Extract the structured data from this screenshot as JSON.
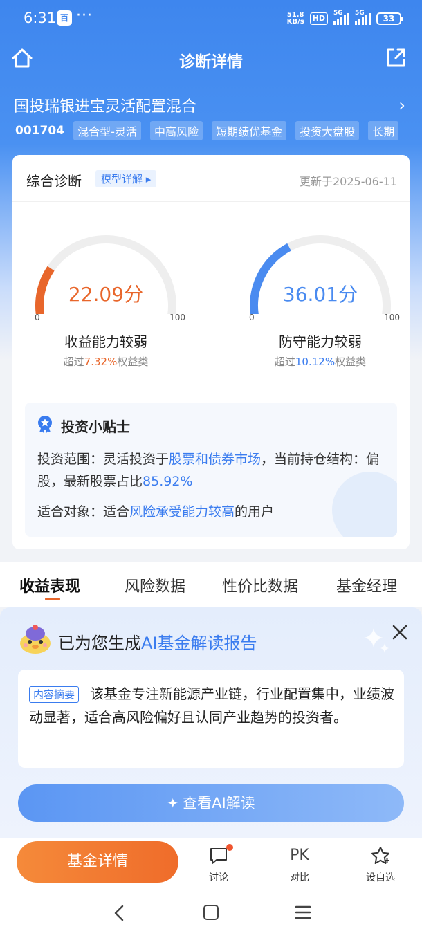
{
  "status_bar": {
    "time": "6:31",
    "app_badge": "百",
    "more": "···",
    "net_speed_value": "51.8",
    "net_speed_unit": "KB/s",
    "hd": "HD",
    "signal1": "5G",
    "signal2": "5G",
    "battery": "33"
  },
  "nav": {
    "title": "诊断详情"
  },
  "fund": {
    "name": "国投瑞银进宝灵活配置混合",
    "code": "001704",
    "tags": [
      "混合型-灵活",
      "中高风险",
      "短期绩优基金",
      "投资大盘股",
      "长期"
    ]
  },
  "diagnosis": {
    "title": "综合诊断",
    "model_link": "模型详解 ▸",
    "update_time": "更新于2025-06-11",
    "return_gauge": {
      "score": "22.09分",
      "score_value": 22.09,
      "min": "0",
      "max": "100",
      "label": "收益能力较弱",
      "sub_prefix": "超过",
      "sub_pct": "7.32%",
      "sub_suffix": "权益类",
      "color": "#e8662b"
    },
    "defense_gauge": {
      "score": "36.01分",
      "score_value": 36.01,
      "min": "0",
      "max": "100",
      "label": "防守能力较弱",
      "sub_prefix": "超过",
      "sub_pct": "10.12%",
      "sub_suffix": "权益类",
      "color": "#4a8bf0"
    },
    "tips": {
      "title": "投资小贴士",
      "scope_prefix": "投资范围：灵活投资于",
      "scope_hl": "股票和债券市场",
      "scope_mid": "，当前持仓结构：偏股，最新股票占比",
      "scope_pct": "85.92%",
      "target_prefix": "适合对象：适合",
      "target_hl": "风险承受能力较高",
      "target_suffix": "的用户"
    }
  },
  "tabs": [
    {
      "label": "收益表现",
      "active": true
    },
    {
      "label": "风险数据",
      "active": false
    },
    {
      "label": "性价比数据",
      "active": false
    },
    {
      "label": "基金经理",
      "active": false
    }
  ],
  "ai": {
    "title_prefix": "已为您生成",
    "title_hl": "AI基金解读报告",
    "summary_tag": "内容摘要",
    "summary_text": "该基金专注新能源产业链，行业配置集中，业绩波动显著，适合高风险偏好且认同产业趋势的投资者。",
    "button": "查看AI解读"
  },
  "bottom_bar": {
    "detail_button": "基金详情",
    "discuss": "讨论",
    "compare_icon": "PK",
    "compare": "对比",
    "watchlist": "设自选"
  },
  "colors": {
    "brand_blue": "#3e86ee",
    "accent_orange": "#e8662b",
    "link_blue": "#3a7cef"
  },
  "icons": [
    "home-icon",
    "share-icon",
    "chevron-right-icon",
    "medal-icon",
    "close-icon",
    "sparkle-icon",
    "comment-icon",
    "star-icon",
    "back-icon",
    "home-square-icon",
    "menu-icon"
  ]
}
